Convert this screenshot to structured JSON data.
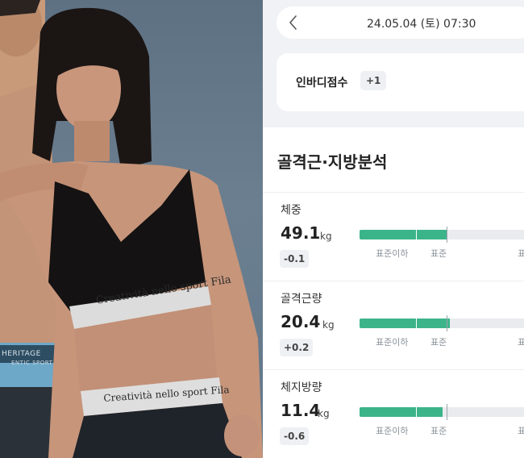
{
  "photo": {
    "band_text_top": "Creatività nello sport Fila",
    "band_text_bottom": "Creatività nello sport Fila",
    "waistband_brand": "HERITAGE",
    "waistband_sub": "ENTIC SPORT"
  },
  "header": {
    "back_icon": "chevron-left-icon",
    "date": "24.05.04 (토) 07:30"
  },
  "score_card": {
    "label": "인바디점수",
    "badge": "+1"
  },
  "analysis": {
    "title": "골격근·지방분석",
    "scale_labels": [
      "표준이하",
      "표준",
      "표"
    ],
    "colors": {
      "bar_fill": "#3cb48a",
      "bar_track": "#e9ebee"
    },
    "metrics": [
      {
        "label": "체중",
        "value": "49.1",
        "unit": "kg",
        "delta": "-0.1",
        "level": 0.49
      },
      {
        "label": "골격근량",
        "value": "20.4",
        "unit": "kg",
        "delta": "+0.2",
        "level": 0.51
      },
      {
        "label": "체지방량",
        "value": "11.4",
        "unit": "kg",
        "delta": "-0.6",
        "level": 0.47
      }
    ]
  }
}
